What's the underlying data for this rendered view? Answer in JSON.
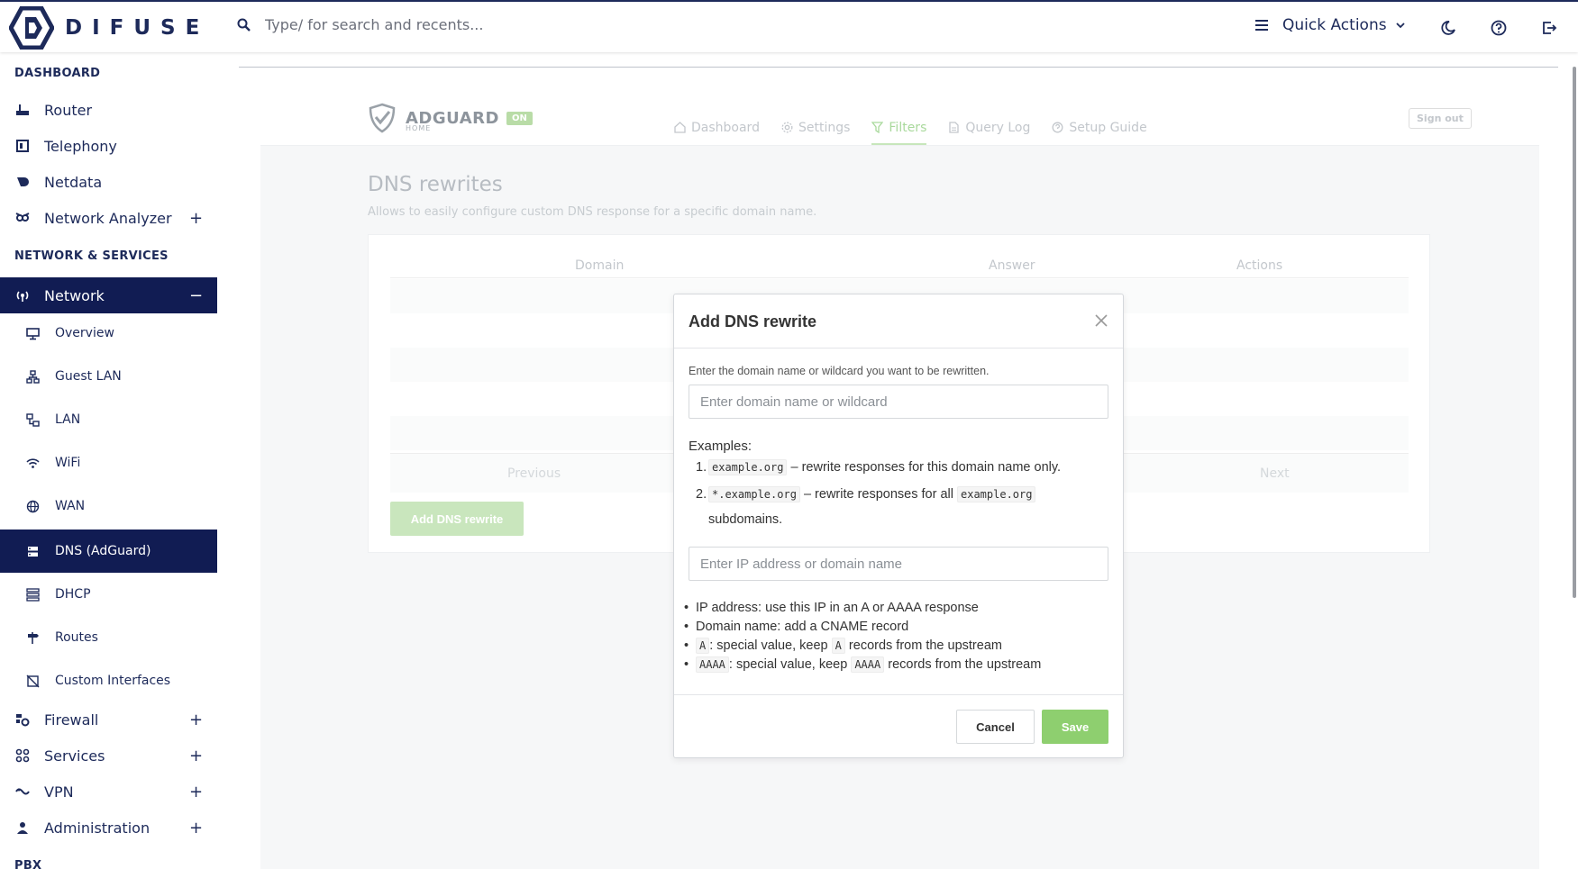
{
  "brand": {
    "name": "DIFUSE"
  },
  "search": {
    "placeholder": "Type/ for search and recents..."
  },
  "quick_actions": {
    "label": "Quick Actions"
  },
  "sidebar": {
    "sections": [
      {
        "title": "DASHBOARD"
      },
      {
        "title": "NETWORK & SERVICES"
      },
      {
        "title": "PBX"
      }
    ],
    "dashboard_items": [
      {
        "label": "Router"
      },
      {
        "label": "Telephony"
      },
      {
        "label": "Netdata"
      },
      {
        "label": "Network Analyzer",
        "expand": "+"
      }
    ],
    "network": {
      "label": "Network",
      "collapse": "−"
    },
    "network_sub": [
      {
        "label": "Overview"
      },
      {
        "label": "Guest LAN"
      },
      {
        "label": "LAN"
      },
      {
        "label": "WiFi"
      },
      {
        "label": "WAN"
      },
      {
        "label": "DNS (AdGuard)"
      },
      {
        "label": "DHCP"
      },
      {
        "label": "Routes"
      },
      {
        "label": "Custom Interfaces"
      }
    ],
    "other_items": [
      {
        "label": "Firewall",
        "expand": "+"
      },
      {
        "label": "Services",
        "expand": "+"
      },
      {
        "label": "VPN",
        "expand": "+"
      },
      {
        "label": "Administration",
        "expand": "+"
      }
    ]
  },
  "adguard": {
    "logo": {
      "name": "ADGUARD",
      "sub": "HOME",
      "status": "ON"
    },
    "tabs": [
      {
        "label": "Dashboard"
      },
      {
        "label": "Settings"
      },
      {
        "label": "Filters"
      },
      {
        "label": "Query Log"
      },
      {
        "label": "Setup Guide"
      }
    ],
    "sign_out": "Sign out",
    "page": {
      "title": "DNS rewrites",
      "subtitle": "Allows to easily configure custom DNS response for a specific domain name."
    },
    "table": {
      "columns": [
        "Domain",
        "Answer",
        "Actions"
      ],
      "previous": "Previous",
      "next": "Next"
    },
    "add_button": "Add DNS rewrite"
  },
  "modal": {
    "title": "Add DNS rewrite",
    "hint": "Enter the domain name or wildcard you want to be rewritten.",
    "domain_placeholder": "Enter domain name or wildcard",
    "examples_label": "Examples:",
    "example1": {
      "num": "1.",
      "code": "example.org",
      "text": "– rewrite responses for this domain name only."
    },
    "example2": {
      "num": "2.",
      "code": "*.example.org",
      "text": "– rewrite responses for all",
      "code2": "example.org",
      "text2": "subdomains."
    },
    "answer_placeholder": "Enter IP address or domain name",
    "bullets": {
      "b1": "IP address: use this IP in an A or AAAA response",
      "b2": "Domain name: add a CNAME record",
      "b3": {
        "code": "A",
        "text": ": special value, keep",
        "code2": "A",
        "text2": "records from the upstream"
      },
      "b4": {
        "code": "AAAA",
        "text": ": special value, keep",
        "code2": "AAAA",
        "text2": "records from the upstream"
      }
    },
    "cancel": "Cancel",
    "save": "Save"
  },
  "colors": {
    "sidebar_active": "#111c53",
    "brand": "#1d2a5a",
    "save": "#8ecf6f"
  }
}
